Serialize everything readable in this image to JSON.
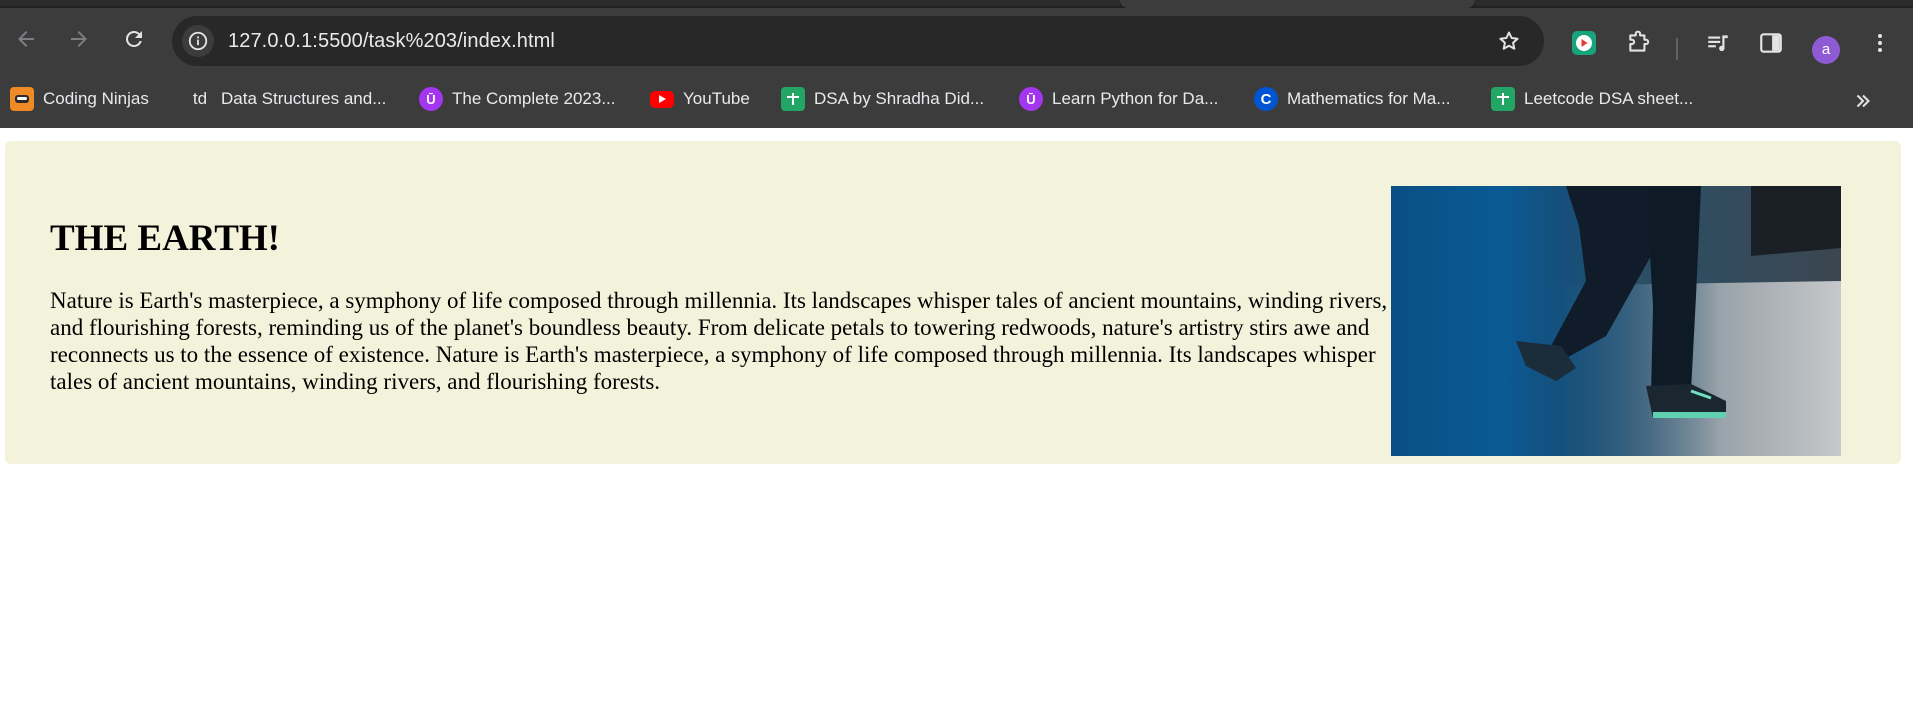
{
  "browser": {
    "url": "127.0.0.1:5500/task%203/index.html",
    "profile_initial": "a",
    "accent_colors": {
      "toolbar": "#3c3c3c",
      "omnibox": "#282828",
      "avatar": "#8e5bd4"
    }
  },
  "bookmarks": [
    {
      "label": "Coding Ninjas",
      "icon": "coding-ninjas-icon"
    },
    {
      "label": "Data Structures and...",
      "icon": "td-icon"
    },
    {
      "label": "The Complete 2023...",
      "icon": "udemy-icon"
    },
    {
      "label": "YouTube",
      "icon": "youtube-icon"
    },
    {
      "label": "DSA by Shradha Did...",
      "icon": "sheets-icon"
    },
    {
      "label": "Learn Python for Da...",
      "icon": "udemy-icon"
    },
    {
      "label": "Mathematics for Ma...",
      "icon": "coursera-icon"
    },
    {
      "label": "Leetcode DSA sheet...",
      "icon": "sheets-icon"
    }
  ],
  "page": {
    "heading": "THE EARTH!",
    "paragraph": "Nature is Earth's masterpiece, a symphony of life composed through millennia. Its landscapes whisper tales of ancient mountains, winding rivers, and flourishing forests, reminding us of the planet's boundless beauty. From delicate petals to towering redwoods, nature's artistry stirs awe and reconnects us to the essence of existence. Nature is Earth's masterpiece, a symphony of life composed through millennia. Its landscapes whisper tales of ancient mountains, winding rivers, and flourishing forests.",
    "card_color": "#f3f3dc"
  }
}
